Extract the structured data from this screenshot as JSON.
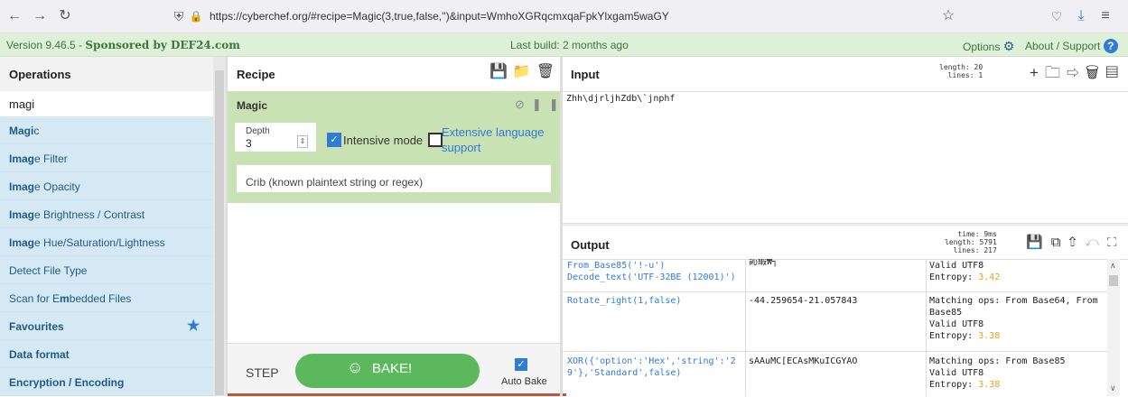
{
  "browser": {
    "url": "https://cyberchef.org/#recipe=Magic(3,true,false,'')&input=WmhoXGRqcmxqaFpkYlxgam5waGY",
    "back_icon": "←",
    "forward_icon": "→",
    "reload_icon": "↻",
    "shield_icon": "⛨",
    "lock_icon": "🔒",
    "star_icon": "☆",
    "pocket_icon": "♡",
    "download_icon": "⤓",
    "menu_icon": "≡"
  },
  "banner": {
    "version": "Version 9.46.5 - ",
    "sponsor": "Sponsored by DEF24.com",
    "last_build": "Last build: 2 months ago",
    "options": "Options",
    "about": "About / Support"
  },
  "operations": {
    "title": "Operations",
    "search_value": "magi",
    "items": [
      {
        "pre": "",
        "hl": "Magi",
        "post": "c"
      },
      {
        "pre": "",
        "hl": "Imag",
        "post": "e Filter"
      },
      {
        "pre": "",
        "hl": "Imag",
        "post": "e Opacity"
      },
      {
        "pre": "",
        "hl": "Imag",
        "post": "e Brightness / Contrast"
      },
      {
        "pre": "",
        "hl": "Imag",
        "post": "e Hue/Saturation/Lightness"
      },
      {
        "pre": "Detect File Type",
        "hl": "",
        "post": ""
      },
      {
        "pre": "Scan for E",
        "hl": "m",
        "post": "bedded Files"
      }
    ],
    "categories": [
      "Favourites",
      "Data format",
      "Encryption / Encoding"
    ]
  },
  "recipe": {
    "title": "Recipe",
    "op_name": "Magic",
    "depth_label": "Depth",
    "depth_value": "3",
    "intensive_label": "Intensive mode",
    "extensive_label": "Extensive language support",
    "crib_placeholder": "Crib (known plaintext string or regex)",
    "step_label": "STEP",
    "bake_label": "BAKE!",
    "auto_bake_label": "Auto Bake"
  },
  "input": {
    "title": "Input",
    "length": "length: 20",
    "lines": "lines:  1",
    "text": "Zhh\\djrljhZdb\\`jnphf"
  },
  "output": {
    "title": "Output",
    "time": "time: 9ms",
    "length": "length: 5791",
    "lines": "lines:  217",
    "rows": [
      {
        "recipe": "From_Base85('!-u')\nDecode_text('UTF-32BE (12001)')",
        "result": "訫緞₩┐",
        "props": [
          "Valid UTF8"
        ],
        "entropy_label": "Entropy: ",
        "entropy": "3.42"
      },
      {
        "recipe": "Rotate_right(1,false)",
        "result": "-44.259654-21.057843",
        "props": [
          "Matching ops: From Base64, From Base85",
          "Valid UTF8"
        ],
        "entropy_label": "Entropy: ",
        "entropy": "3.38"
      },
      {
        "recipe": "XOR({'option':'Hex','string':'29'},'Standard',false)",
        "result": "sAAuMC[ECAsMKuICGYAO",
        "props": [
          "Matching ops: From Base85",
          "Valid UTF8"
        ],
        "entropy_label": "Entropy: ",
        "entropy": "3.38"
      }
    ]
  }
}
